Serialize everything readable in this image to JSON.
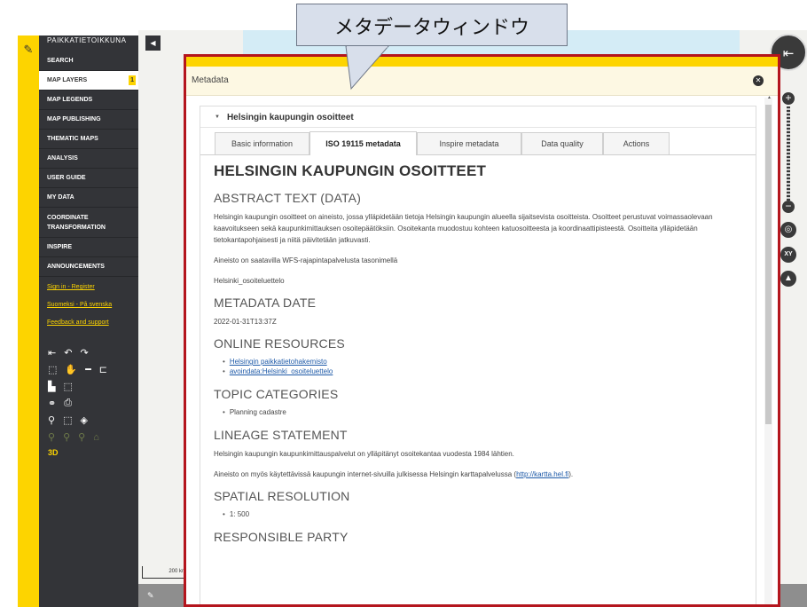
{
  "callout": {
    "text": "メタデータウィンドウ"
  },
  "sidebar": {
    "brand": "PAIKKATIETOIKKUNA",
    "menu": [
      {
        "label": "SEARCH"
      },
      {
        "label": "MAP LAYERS",
        "badge": "1"
      },
      {
        "label": "MAP LEGENDS"
      },
      {
        "label": "MAP PUBLISHING"
      },
      {
        "label": "THEMATIC MAPS"
      },
      {
        "label": "ANALYSIS"
      },
      {
        "label": "USER GUIDE"
      },
      {
        "label": "MY DATA"
      },
      {
        "label": "COORDINATE TRANSFORMATION"
      },
      {
        "label": "INSPIRE"
      },
      {
        "label": "ANNOUNCEMENTS"
      }
    ],
    "auth_links": "Sign in - Register",
    "language_links": "Suomeksi - På svenska",
    "feedback_link": "Feedback and support",
    "three_d": "3D"
  },
  "map": {
    "scale_label": "200 km"
  },
  "metadata": {
    "window_title": "Metadata",
    "layer_title": "Helsingin kaupungin osoitteet",
    "tabs": [
      "Basic information",
      "ISO 19115 metadata",
      "Inspire metadata",
      "Data quality",
      "Actions"
    ],
    "active_tab": "ISO 19115 metadata",
    "heading": "HELSINGIN KAUPUNGIN OSOITTEET",
    "abstract_heading": "ABSTRACT TEXT (DATA)",
    "abstract_p1": "Helsingin kaupungin osoitteet on aineisto, jossa ylläpidetään tietoja Helsingin kaupungin alueella sijaitsevista osoitteista. Osoitteet perustuvat voimassaolevaan kaavoitukseen sekä kaupunkimittauksen osoitepäätöksiin. Osoitekanta muodostuu kohteen katuosoitteesta ja koordinaattipisteestä. Osoitteita ylläpidetään tietokantapohjaisesti ja niitä päivitetään jatkuvasti.",
    "abstract_p2": "Aineisto on saatavilla WFS-rajapintapalvelusta tasonimellä",
    "abstract_p3": "Helsinki_osoiteluettelo",
    "date_heading": "METADATA DATE",
    "date_value": "2022-01-31T13:37Z",
    "online_heading": "ONLINE RESOURCES",
    "online_links": [
      "Helsingin paikkatietohakemisto",
      "avoindata:Helsinki_osoiteluettelo"
    ],
    "topic_heading": "TOPIC CATEGORIES",
    "topic_items": [
      "Planning cadastre"
    ],
    "lineage_heading": "LINEAGE STATEMENT",
    "lineage_p1": "Helsingin kaupungin kaupunkimittauspalvelut on ylläpitänyt osoitekantaa vuodesta 1984 lähtien.",
    "lineage_p2_text": "Aineisto on myös käytettävissä kaupungin internet-sivuilla julkisessa Helsingin karttapalvelussa (",
    "lineage_p2_link": "http://kartta.hel.fi",
    "lineage_p2_end": ").",
    "spatial_heading": "SPATIAL RESOLUTION",
    "spatial_items": [
      "1: 500"
    ],
    "responsible_heading": "RESPONSIBLE PARTY"
  }
}
